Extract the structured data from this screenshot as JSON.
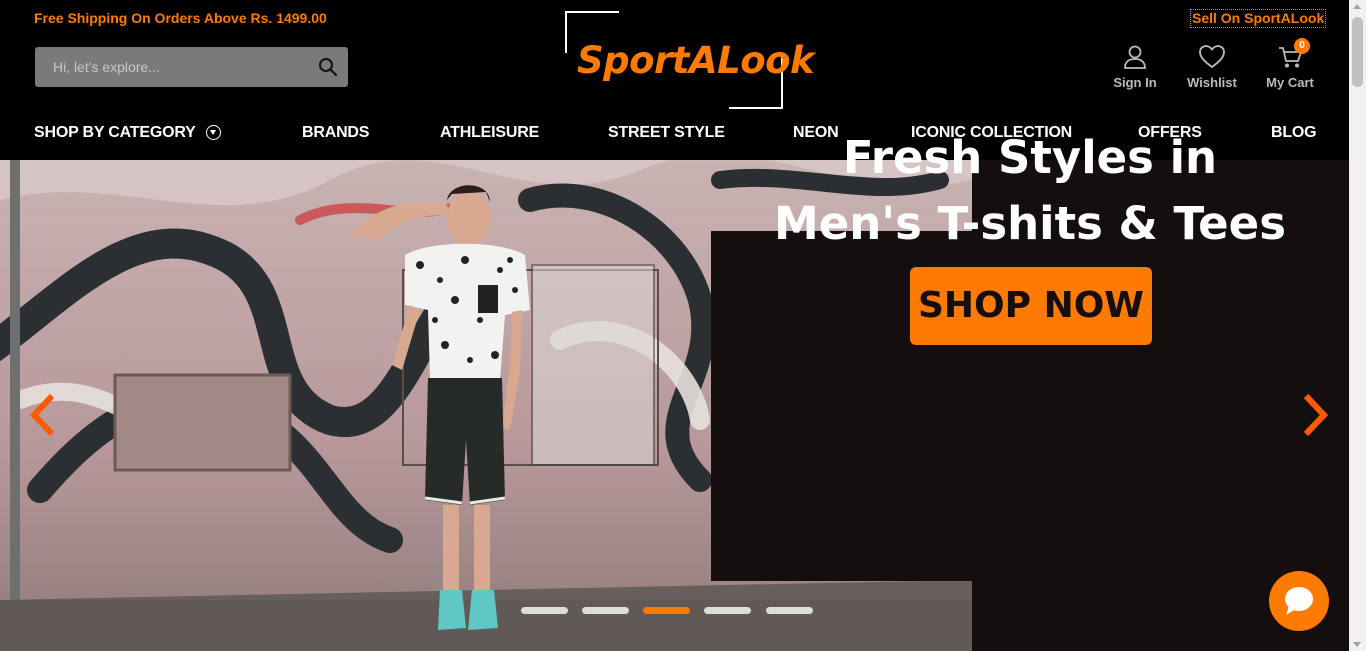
{
  "header": {
    "promo_text": "Free Shipping On Orders Above Rs. 1499.00",
    "sell_link": "Sell On SportALook",
    "search_placeholder": "Hi, let's explore...",
    "logo_text": "SportALook",
    "sign_in_label": "Sign In",
    "wishlist_label": "Wishlist",
    "cart_label": "My Cart",
    "cart_count": "0"
  },
  "nav": {
    "items": [
      {
        "label": "SHOP BY CATEGORY"
      },
      {
        "label": "BRANDS"
      },
      {
        "label": "ATHLEISURE"
      },
      {
        "label": "STREET STYLE"
      },
      {
        "label": "NEON"
      },
      {
        "label": "ICONIC COLLECTION"
      },
      {
        "label": "OFFERS"
      },
      {
        "label": "BLOG"
      }
    ]
  },
  "hero": {
    "headline_line1": "Fresh Styles in",
    "headline_line2": "Men's T-shits & Tees",
    "cta_label": "SHOP NOW",
    "slide_count": 5,
    "active_slide": 3
  },
  "colors": {
    "accent": "#ff7a00",
    "background": "#000000",
    "panel": "#140e0e"
  },
  "icons": [
    "search-icon",
    "user-icon",
    "heart-icon",
    "cart-icon",
    "chevron-left-icon",
    "chevron-right-icon",
    "chat-icon",
    "chevron-down-icon"
  ]
}
